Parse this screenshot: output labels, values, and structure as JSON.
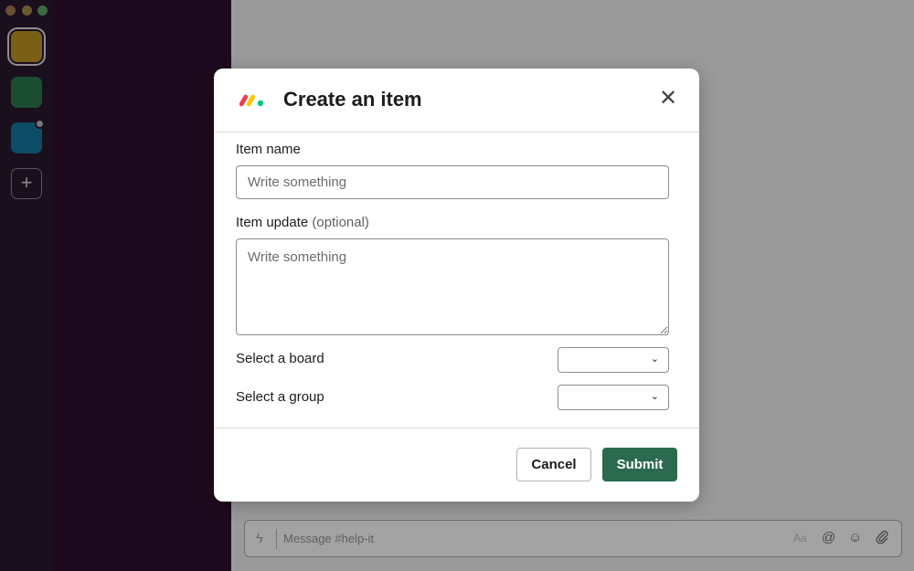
{
  "app": {
    "composer": {
      "placeholder": "Message #help-it",
      "icons": [
        "lightning-icon",
        "format-text-icon",
        "mention-icon",
        "emoji-icon",
        "attachment-icon"
      ],
      "format_label": "Aa"
    },
    "workspaces": [
      {
        "color": "#7a5f17"
      },
      {
        "color": "#1b4d33"
      },
      {
        "color": "#0c4c66"
      }
    ],
    "add_workspace_symbol": "+"
  },
  "modal": {
    "title": "Create an item",
    "logo_colors": [
      "#e44258",
      "#fecb00",
      "#00c875"
    ],
    "close_symbol": "✕",
    "fields": {
      "item_name": {
        "label": "Item name",
        "placeholder": "Write something",
        "value": ""
      },
      "item_update": {
        "label": "Item update",
        "optional": "(optional)",
        "placeholder": "Write something",
        "value": ""
      },
      "board": {
        "label": "Select a board",
        "value": ""
      },
      "group": {
        "label": "Select a group",
        "value": ""
      }
    },
    "buttons": {
      "cancel": "Cancel",
      "submit": "Submit"
    }
  },
  "colors": {
    "submit_bg": "#2b6a4f",
    "overlay": "#9a9a9a"
  }
}
